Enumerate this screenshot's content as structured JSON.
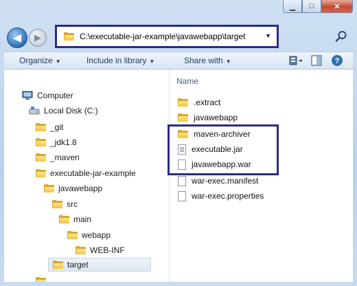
{
  "window": {
    "caption_buttons": {
      "minimize": "▁",
      "maximize": "□",
      "close": "✕"
    }
  },
  "nav": {
    "back": "◀",
    "forward": "▶"
  },
  "address": {
    "path": "C:\\executable-jar-example\\javawebapp\\target",
    "dropdown": "▼"
  },
  "toolbar": {
    "organize": "Organize",
    "include": "Include in library",
    "share": "Share with",
    "arrow": "▼"
  },
  "tree": {
    "computer": "Computer",
    "disk": "Local Disk (C:)",
    "items": [
      {
        "label": "_git"
      },
      {
        "label": "_jdk1.8"
      },
      {
        "label": "_maven"
      },
      {
        "label": "executable-jar-example"
      },
      {
        "label": "javawebapp"
      },
      {
        "label": "src"
      },
      {
        "label": "main"
      },
      {
        "label": "webapp"
      },
      {
        "label": "WEB-INF"
      },
      {
        "label": "target"
      }
    ]
  },
  "files": {
    "column_name": "Name",
    "items": [
      {
        "label": ".extract",
        "icon": "folder-icon"
      },
      {
        "label": "javawebapp",
        "icon": "folder-icon"
      },
      {
        "label": "maven-archiver",
        "icon": "folder-icon"
      },
      {
        "label": "executable.jar",
        "icon": "jar-file-icon"
      },
      {
        "label": "javawebapp.war",
        "icon": "file-icon"
      },
      {
        "label": "war-exec.manifest",
        "icon": "file-icon"
      },
      {
        "label": "war-exec.properties",
        "icon": "file-icon"
      }
    ]
  },
  "colors": {
    "highlight": "#2a2a86",
    "folder": "#f2c34a"
  }
}
